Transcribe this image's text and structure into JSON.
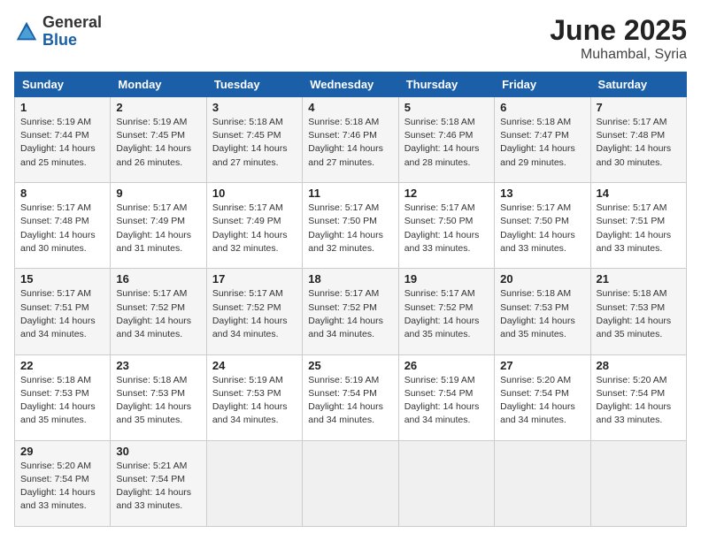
{
  "logo": {
    "general": "General",
    "blue": "Blue"
  },
  "title": "June 2025",
  "location": "Muhambal, Syria",
  "weekdays": [
    "Sunday",
    "Monday",
    "Tuesday",
    "Wednesday",
    "Thursday",
    "Friday",
    "Saturday"
  ],
  "weeks": [
    [
      {
        "day": "1",
        "sunrise": "5:19 AM",
        "sunset": "7:44 PM",
        "daylight": "14 hours and 25 minutes."
      },
      {
        "day": "2",
        "sunrise": "5:19 AM",
        "sunset": "7:45 PM",
        "daylight": "14 hours and 26 minutes."
      },
      {
        "day": "3",
        "sunrise": "5:18 AM",
        "sunset": "7:45 PM",
        "daylight": "14 hours and 27 minutes."
      },
      {
        "day": "4",
        "sunrise": "5:18 AM",
        "sunset": "7:46 PM",
        "daylight": "14 hours and 27 minutes."
      },
      {
        "day": "5",
        "sunrise": "5:18 AM",
        "sunset": "7:46 PM",
        "daylight": "14 hours and 28 minutes."
      },
      {
        "day": "6",
        "sunrise": "5:18 AM",
        "sunset": "7:47 PM",
        "daylight": "14 hours and 29 minutes."
      },
      {
        "day": "7",
        "sunrise": "5:17 AM",
        "sunset": "7:48 PM",
        "daylight": "14 hours and 30 minutes."
      }
    ],
    [
      {
        "day": "8",
        "sunrise": "5:17 AM",
        "sunset": "7:48 PM",
        "daylight": "14 hours and 30 minutes."
      },
      {
        "day": "9",
        "sunrise": "5:17 AM",
        "sunset": "7:49 PM",
        "daylight": "14 hours and 31 minutes."
      },
      {
        "day": "10",
        "sunrise": "5:17 AM",
        "sunset": "7:49 PM",
        "daylight": "14 hours and 32 minutes."
      },
      {
        "day": "11",
        "sunrise": "5:17 AM",
        "sunset": "7:50 PM",
        "daylight": "14 hours and 32 minutes."
      },
      {
        "day": "12",
        "sunrise": "5:17 AM",
        "sunset": "7:50 PM",
        "daylight": "14 hours and 33 minutes."
      },
      {
        "day": "13",
        "sunrise": "5:17 AM",
        "sunset": "7:50 PM",
        "daylight": "14 hours and 33 minutes."
      },
      {
        "day": "14",
        "sunrise": "5:17 AM",
        "sunset": "7:51 PM",
        "daylight": "14 hours and 33 minutes."
      }
    ],
    [
      {
        "day": "15",
        "sunrise": "5:17 AM",
        "sunset": "7:51 PM",
        "daylight": "14 hours and 34 minutes."
      },
      {
        "day": "16",
        "sunrise": "5:17 AM",
        "sunset": "7:52 PM",
        "daylight": "14 hours and 34 minutes."
      },
      {
        "day": "17",
        "sunrise": "5:17 AM",
        "sunset": "7:52 PM",
        "daylight": "14 hours and 34 minutes."
      },
      {
        "day": "18",
        "sunrise": "5:17 AM",
        "sunset": "7:52 PM",
        "daylight": "14 hours and 34 minutes."
      },
      {
        "day": "19",
        "sunrise": "5:17 AM",
        "sunset": "7:52 PM",
        "daylight": "14 hours and 35 minutes."
      },
      {
        "day": "20",
        "sunrise": "5:18 AM",
        "sunset": "7:53 PM",
        "daylight": "14 hours and 35 minutes."
      },
      {
        "day": "21",
        "sunrise": "5:18 AM",
        "sunset": "7:53 PM",
        "daylight": "14 hours and 35 minutes."
      }
    ],
    [
      {
        "day": "22",
        "sunrise": "5:18 AM",
        "sunset": "7:53 PM",
        "daylight": "14 hours and 35 minutes."
      },
      {
        "day": "23",
        "sunrise": "5:18 AM",
        "sunset": "7:53 PM",
        "daylight": "14 hours and 35 minutes."
      },
      {
        "day": "24",
        "sunrise": "5:19 AM",
        "sunset": "7:53 PM",
        "daylight": "14 hours and 34 minutes."
      },
      {
        "day": "25",
        "sunrise": "5:19 AM",
        "sunset": "7:54 PM",
        "daylight": "14 hours and 34 minutes."
      },
      {
        "day": "26",
        "sunrise": "5:19 AM",
        "sunset": "7:54 PM",
        "daylight": "14 hours and 34 minutes."
      },
      {
        "day": "27",
        "sunrise": "5:20 AM",
        "sunset": "7:54 PM",
        "daylight": "14 hours and 34 minutes."
      },
      {
        "day": "28",
        "sunrise": "5:20 AM",
        "sunset": "7:54 PM",
        "daylight": "14 hours and 33 minutes."
      }
    ],
    [
      {
        "day": "29",
        "sunrise": "5:20 AM",
        "sunset": "7:54 PM",
        "daylight": "14 hours and 33 minutes."
      },
      {
        "day": "30",
        "sunrise": "5:21 AM",
        "sunset": "7:54 PM",
        "daylight": "14 hours and 33 minutes."
      },
      null,
      null,
      null,
      null,
      null
    ]
  ]
}
